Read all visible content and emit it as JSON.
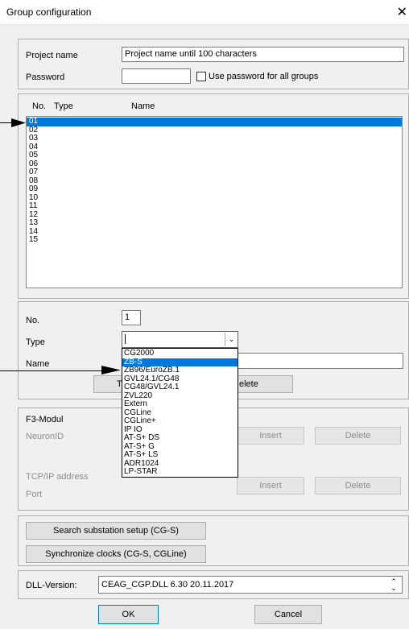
{
  "title": "Group configuration",
  "project": {
    "name_label": "Project name",
    "name_value": "Project name until 100 characters",
    "password_label": "Password",
    "use_password_label": "Use password for all groups"
  },
  "list": {
    "col_no": "No.",
    "col_type": "Type",
    "col_name": "Name",
    "rows": [
      "01",
      "02",
      "03",
      "04",
      "05",
      "06",
      "07",
      "08",
      "09",
      "10",
      "11",
      "12",
      "13",
      "14",
      "15"
    ],
    "selected_index": 0
  },
  "detail": {
    "no_label": "No.",
    "no_value": "1",
    "type_label": "Type",
    "name_label": "Name",
    "btn_partial_left": "T",
    "btn_partial_right": "elete"
  },
  "dropdown": {
    "options": [
      "CG2000",
      "ZB-S",
      "ZB96/EuroZB.1",
      "GVL24.1/CG48",
      "CG48/GVL24.1",
      "ZVL220",
      "Extern",
      "CGLine",
      "CGLine+",
      "IP IO",
      "AT-S+ DS",
      "AT-S+ G",
      "AT-S+ LS",
      "ADR1024",
      "LP-STAR"
    ],
    "selected_index": 1
  },
  "f3": {
    "title": "F3-Modul",
    "neuron_label": "NeuronID",
    "insert_label": "Insert",
    "delete_label": "Delete",
    "tcp_label": "TCP/IP address",
    "port_label": "Port",
    "insert2_label": "Insert",
    "delete2_label": "Delete"
  },
  "actions": {
    "search_label": "Search substation setup (CG-S)",
    "sync_label": "Synchronize clocks (CG-S, CGLine)"
  },
  "dll": {
    "label": "DLL-Version:",
    "value": "CEAG_CGP.DLL 6.30 20.11.2017"
  },
  "footer": {
    "ok_label": "OK",
    "cancel_label": "Cancel"
  }
}
